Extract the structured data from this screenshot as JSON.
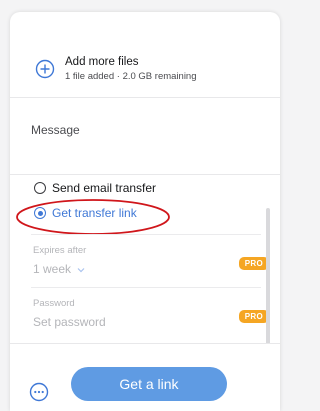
{
  "upload": {
    "title": "Add more files",
    "subtitle": "1 file added · 2.0 GB remaining",
    "icon": "plus-circle-icon"
  },
  "message": {
    "placeholder": "Message"
  },
  "options": {
    "email": "Send email transfer",
    "link": "Get transfer link",
    "selected": "link"
  },
  "fields": {
    "expires": {
      "label": "Expires after",
      "value": "1 week",
      "badge": "PRO"
    },
    "password": {
      "label": "Password",
      "value": "Set password",
      "badge": "PRO"
    }
  },
  "footer": {
    "more_icon": "more-horizontal-circle-icon",
    "cta": "Get a link"
  },
  "colors": {
    "accent": "#3f78d6",
    "cta": "#5f9be3",
    "pro_badge": "#f5a623",
    "highlight": "#d0161b"
  }
}
